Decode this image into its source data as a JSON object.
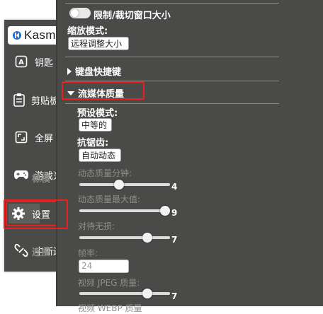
{
  "sidebar": {
    "logo_text": "Kasm",
    "items": [
      {
        "label": "钥匙",
        "icon": "keyboard-a-icon"
      },
      {
        "label": "剪贴板",
        "icon": "clipboard-icon"
      },
      {
        "label": "全屏",
        "icon": "fullscreen-icon"
      },
      {
        "label": "游戏光标模",
        "icon": "gamepad-icon"
      },
      {
        "label": "设置",
        "icon": "gear-icon"
      },
      {
        "label": "中断连接",
        "icon": "disconnect-icon"
      }
    ]
  },
  "panel": {
    "clip_label": "限制/裁切窗口大小",
    "scale_label": "缩放模式:",
    "scale_value": "远程调整大小",
    "keyboard_section": "键盘快捷键",
    "stream_section": "流媒体质量",
    "preset_label": "预设模式:",
    "preset_value": "中等的",
    "aa_label": "抗锯齿:",
    "aa_value": "自动动态",
    "dyn_min_label": "动态质量分钟:",
    "dyn_min_value": "4",
    "dyn_max_label": "动态质量最大值:",
    "dyn_max_value": "9",
    "lossless_label": "对待无损:",
    "lossless_value": "7",
    "fps_label": "帧率:",
    "fps_value": "24",
    "jpeg_label": "视频 JPEG 质量:",
    "jpeg_value": "7",
    "webp_label": "视频 WEBP 质量"
  },
  "colors": {
    "panel_bg": "#4a4a48",
    "highlight": "#e8201e"
  }
}
